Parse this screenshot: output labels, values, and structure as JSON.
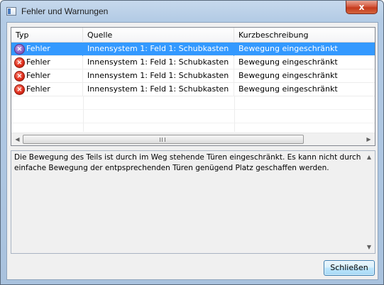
{
  "window": {
    "title": "Fehler und Warnungen",
    "close_glyph": "x"
  },
  "table": {
    "columns": [
      "Typ",
      "Quelle",
      "Kurzbeschreibung"
    ],
    "rows": [
      {
        "type": "Fehler",
        "source": "Innensystem 1: Feld 1: Schubkasten",
        "summary": "Bewegung eingeschränkt",
        "icon": "error-icon",
        "selected": true
      },
      {
        "type": "Fehler",
        "source": "Innensystem 1: Feld 1: Schubkasten",
        "summary": "Bewegung eingeschränkt",
        "icon": "error-icon",
        "selected": false
      },
      {
        "type": "Fehler",
        "source": "Innensystem 1: Feld 1: Schubkasten",
        "summary": "Bewegung eingeschränkt",
        "icon": "error-icon",
        "selected": false
      },
      {
        "type": "Fehler",
        "source": "Innensystem 1: Feld 1: Schubkasten",
        "summary": "Bewegung eingeschränkt",
        "icon": "error-icon",
        "selected": false
      }
    ]
  },
  "description": {
    "text": "Die Bewegung des Teils ist durch im Weg stehende Türen eingeschränkt. Es kann nicht durch einfache Bewegung der entpsprechenden Türen genügend Platz geschaffen werden."
  },
  "buttons": {
    "close_label": "Schließen"
  },
  "colors": {
    "selection": "#3399ff",
    "error": "#e0301e"
  }
}
